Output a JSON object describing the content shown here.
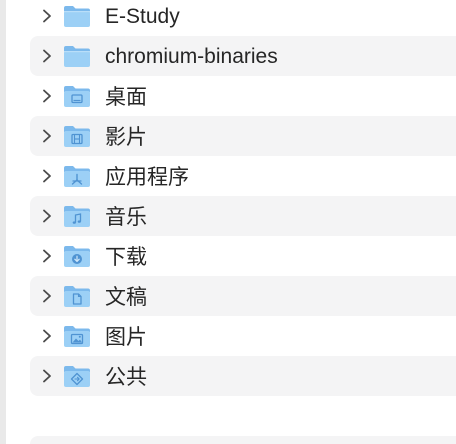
{
  "folders": [
    {
      "name": "E-Study",
      "glyph": "none",
      "expanded": false
    },
    {
      "name": "chromium-binaries",
      "glyph": "none",
      "expanded": false
    },
    {
      "name": "桌面",
      "glyph": "desktop-icon",
      "expanded": false
    },
    {
      "name": "影片",
      "glyph": "film-icon",
      "expanded": false
    },
    {
      "name": "应用程序",
      "glyph": "applications-icon",
      "expanded": false
    },
    {
      "name": "音乐",
      "glyph": "music-note-icon",
      "expanded": false
    },
    {
      "name": "下载",
      "glyph": "download-icon",
      "expanded": false
    },
    {
      "name": "文稿",
      "glyph": "document-icon",
      "expanded": false
    },
    {
      "name": "图片",
      "glyph": "picture-icon",
      "expanded": false
    },
    {
      "name": "公共",
      "glyph": "public-icon",
      "expanded": false
    }
  ],
  "colors": {
    "folder_body": "#7cb9ec",
    "folder_front": "#9cd0f6",
    "folder_glyph": "#4f93d2",
    "chevron": "#4a4a4a",
    "row_alt": "#f4f4f5",
    "text": "#262626"
  }
}
